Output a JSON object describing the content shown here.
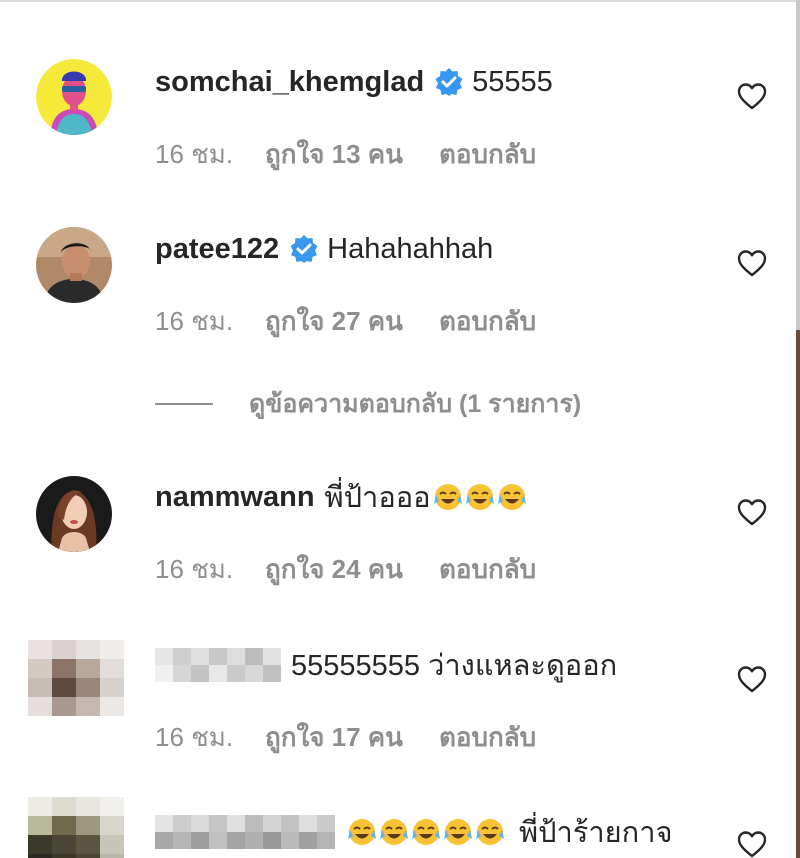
{
  "comments": [
    {
      "username": "somchai_khemglad",
      "verified": true,
      "text": "55555",
      "time": "16 ชม.",
      "likes": "ถูกใจ 13 คน",
      "reply": "ตอบกลับ",
      "avatar": "avatar-yellow-pop-art"
    },
    {
      "username": "patee122",
      "verified": true,
      "text": "Hahahahhah",
      "time": "16 ชม.",
      "likes": "ถูกใจ 27 คน",
      "reply": "ตอบกลับ",
      "avatar": "avatar-man-photo"
    },
    {
      "username": "nammwann",
      "verified": false,
      "text": "พี่ป้าอออ",
      "emojis": [
        "joy-emoji",
        "joy-emoji",
        "joy-emoji"
      ],
      "time": "16 ชม.",
      "likes": "ถูกใจ 24 คน",
      "reply": "ตอบกลับ",
      "avatar": "avatar-woman-photo"
    },
    {
      "username": "",
      "username_blurred": true,
      "verified": false,
      "text": "55555555 ว่างแหละดูออก",
      "time": "16 ชม.",
      "likes": "ถูกใจ 17 คน",
      "reply": "ตอบกลับ",
      "avatar": "avatar-blurred"
    },
    {
      "username": "",
      "username_blurred": true,
      "verified": false,
      "emojis": [
        "joy-emoji",
        "joy-emoji",
        "joy-emoji",
        "joy-emoji",
        "joy-emoji"
      ],
      "text": "พี่ป้าร้ายกาจ",
      "avatar": "avatar-blurred"
    }
  ],
  "view_replies": "ดูข้อความตอบกลับ (1 รายการ)",
  "colors": {
    "text": "#262626",
    "meta": "#8e8e8e",
    "verified": "#3897f0",
    "heart_outline": "#262626"
  }
}
